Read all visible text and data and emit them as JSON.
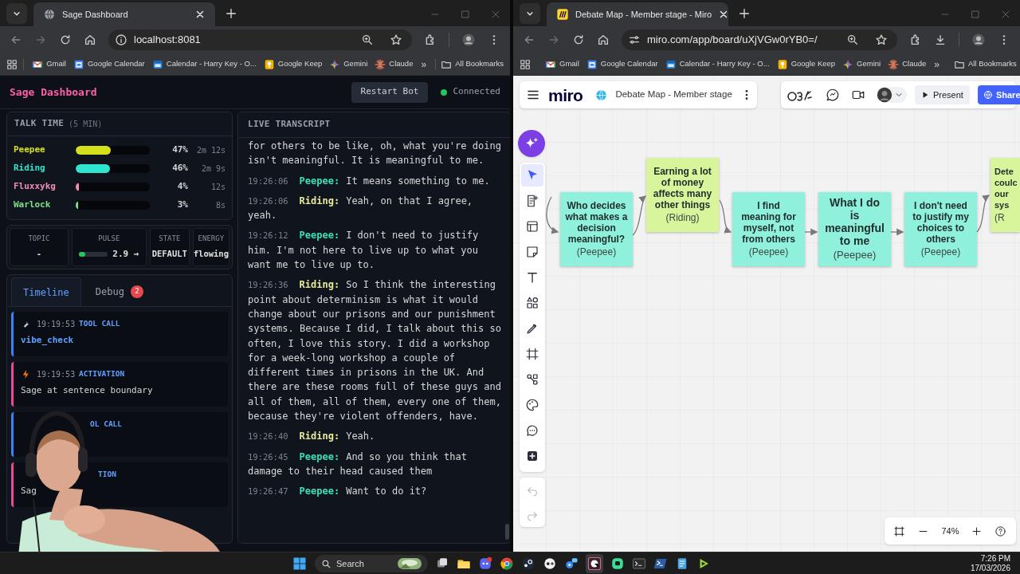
{
  "left_window": {
    "tab_title": "Sage Dashboard",
    "address": "localhost:8081",
    "bookmarks": [
      {
        "label": "Gmail"
      },
      {
        "label": "Google Calendar"
      },
      {
        "label": "Calendar - Harry Key - O..."
      },
      {
        "label": "Google Keep"
      },
      {
        "label": "Gemini"
      },
      {
        "label": "Claude"
      }
    ],
    "more_bookmarks": "»",
    "all_bookmarks": "All Bookmarks",
    "dashboard": {
      "title": "Sage Dashboard",
      "restart_button": "Restart Bot",
      "connection": {
        "label": "Connected",
        "connected": true
      },
      "talk_time": {
        "title": "TALK TIME",
        "window": "(5 MIN)",
        "speakers": [
          {
            "name": "Peepee",
            "color": "#d4e01c",
            "level": 0.47,
            "percent": "47%",
            "duration": "2m 12s"
          },
          {
            "name": "Riding",
            "color": "#2ee6cf",
            "level": 0.46,
            "percent": "46%",
            "duration": "2m 9s"
          },
          {
            "name": "Fluxxykg",
            "color": "#f28bb0",
            "level": 0.04,
            "percent": "4%",
            "duration": "12s"
          },
          {
            "name": "Warlock",
            "color": "#7ee08a",
            "level": 0.03,
            "percent": "3%",
            "duration": "8s"
          }
        ]
      },
      "stats": [
        {
          "kind": "text",
          "label": "TOPIC",
          "value": "-"
        },
        {
          "kind": "meter",
          "label": "PULSE",
          "level": 0.22,
          "value": "2.9 →"
        },
        {
          "kind": "text",
          "label": "STATE",
          "value": "DEFAULT"
        },
        {
          "kind": "text",
          "label": "ENERGY",
          "value": "flowing"
        }
      ],
      "tabs": [
        {
          "label": "Timeline",
          "selected": true
        },
        {
          "label": "Debug",
          "selected": false,
          "badge": "2"
        }
      ],
      "timeline": [
        {
          "kind": "tool",
          "time": "19:19:53",
          "label": "TOOL CALL",
          "text": "vibe_check"
        },
        {
          "kind": "activation",
          "time": "19:19:53",
          "label": "ACTIVATION",
          "text": "Sage at sentence boundary"
        },
        {
          "kind": "tool",
          "label": "OL CALL"
        },
        {
          "kind": "activation",
          "label": "TION",
          "text": "Sag"
        }
      ],
      "transcript": {
        "title": "LIVE TRANSCRIPT",
        "entries": [
          {
            "text": "for others to be like, oh, what you're doing isn't meaningful. It is meaningful to me."
          },
          {
            "time": "19:26:06",
            "speaker": "Peepee:",
            "color": "#3be0b4",
            "text": "It means something to me."
          },
          {
            "time": "19:26:06",
            "speaker": "Riding:",
            "color": "#e6e89a",
            "text": "Yeah, on that I agree, yeah."
          },
          {
            "time": "19:26:12",
            "speaker": "Peepee:",
            "color": "#3be0b4",
            "text": "I don't need to justify him. I'm not here to live up to what you want me to live up to."
          },
          {
            "time": "19:26:36",
            "speaker": "Riding:",
            "color": "#e6e89a",
            "text": "So I think the interesting point about determinism is what it would change about our prisons and our punishment systems. Because I did, I talk about this so often, I love this story. I did a workshop for a week-long workshop a couple of different times in prisons in the UK. And there are these rooms full of these guys and all of them, all of them, every one of them, because they're violent offenders, have."
          },
          {
            "time": "19:26:40",
            "speaker": "Riding:",
            "color": "#e6e89a",
            "text": "Yeah."
          },
          {
            "time": "19:26:45",
            "speaker": "Peepee:",
            "color": "#3be0b4",
            "text": "And so you think that damage to their head caused them"
          },
          {
            "time": "19:26:47",
            "speaker": "Peepee:",
            "color": "#3be0b4",
            "text": "Want to do it?"
          }
        ]
      }
    }
  },
  "right_window": {
    "tab_title": "Debate Map - Member stage - Miro",
    "address": "miro.com/app/board/uXjVGw0rYB0=/",
    "bookmarks": [
      {
        "label": "Gmail"
      },
      {
        "label": "Google Calendar"
      },
      {
        "label": "Calendar - Harry Key - O..."
      },
      {
        "label": "Google Keep"
      },
      {
        "label": "Gemini"
      },
      {
        "label": "Claude"
      }
    ],
    "more_bookmarks": "»",
    "all_bookmarks": "All Bookmarks",
    "miro": {
      "logo": "miro",
      "board_title": "Debate Map - Member stage",
      "present_button": "Present",
      "share_button": "Share",
      "zoom": "74%",
      "notes": [
        {
          "text": "Who decides what makes a decision meaningful?",
          "author": "(Peepee)",
          "color": "#8ff0dc"
        },
        {
          "text": "Earning a lot of money affects many other things",
          "author": "(Riding)",
          "color": "#d8f59c"
        },
        {
          "text": "I find meaning for myself, not from others",
          "author": "(Peepee)",
          "color": "#8ff0dc"
        },
        {
          "text": "What I do is meaningful to me",
          "author": "(Peepee)",
          "color": "#8ff0dc"
        },
        {
          "text": "I don't need to justify my choices to others",
          "author": "(Peepee)",
          "color": "#8ff0dc"
        },
        {
          "text": "Dete\ncoulc\nour\nsys",
          "author": "(R",
          "color": "#d8f59c"
        }
      ]
    }
  },
  "taskbar": {
    "search_placeholder": "Search",
    "time": "7:26 PM",
    "date": "17/03/2026"
  }
}
